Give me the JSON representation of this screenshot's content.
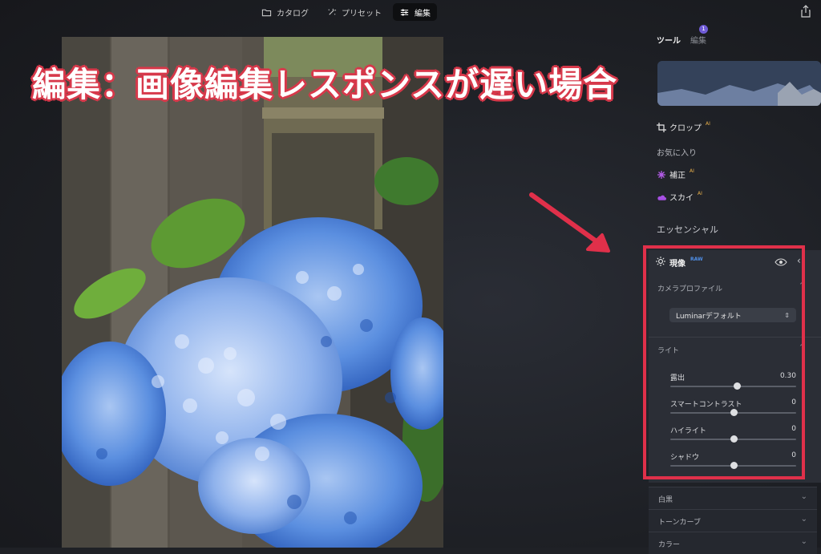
{
  "topnav": {
    "catalog": "カタログ",
    "presets": "プリセット",
    "edit": "編集"
  },
  "headline": "編集：画像編集レスポンスが遅い場合",
  "panel": {
    "tabs": {
      "tools": "ツール",
      "edits": "編集",
      "edits_badge": "1"
    },
    "tools": {
      "crop": "クロップ",
      "crop_badge": "AI",
      "favorites": "お気に入り",
      "enhance": "補正",
      "enhance_badge": "AI",
      "sky": "スカイ",
      "sky_badge": "AI"
    },
    "essentials_title": "エッセンシャル",
    "develop": {
      "title": "現像",
      "badge": "RAW",
      "camera_profile_label": "カメラプロファイル",
      "profile_value": "Luminarデフォルト",
      "light_label": "ライト",
      "sliders": [
        {
          "label": "露出",
          "value": "0.30",
          "position": 0.53
        },
        {
          "label": "スマートコントラスト",
          "value": "0",
          "position": 0.5
        },
        {
          "label": "ハイライト",
          "value": "0",
          "position": 0.5
        },
        {
          "label": "シャドウ",
          "value": "0",
          "position": 0.5
        }
      ]
    },
    "collapsed_sections": [
      "白黒",
      "トーンカーブ",
      "カラー"
    ]
  },
  "colors": {
    "annotation_red": "#e0304a",
    "accent_purple": "#6f5bd6",
    "ai_badge": "#e8b04a",
    "raw_badge": "#4f8fe8"
  }
}
